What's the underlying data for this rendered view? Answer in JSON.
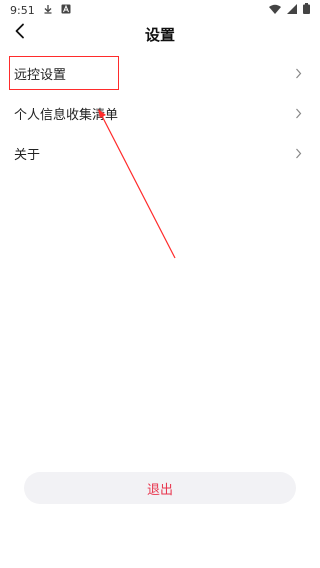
{
  "status_bar": {
    "time": "9:51"
  },
  "header": {
    "title": "设置"
  },
  "menu": {
    "items": [
      {
        "label": "远控设置"
      },
      {
        "label": "个人信息收集清单"
      },
      {
        "label": "关于"
      }
    ]
  },
  "footer": {
    "logout_label": "退出"
  },
  "colors": {
    "accent": "#e8374f",
    "annotation": "#ff2b2b",
    "button_bg": "#f2f2f5"
  },
  "icons": [
    "download-icon",
    "a-icon",
    "wifi-icon",
    "signal-icon",
    "battery-icon",
    "back-arrow-icon",
    "chevron-right-icon"
  ]
}
